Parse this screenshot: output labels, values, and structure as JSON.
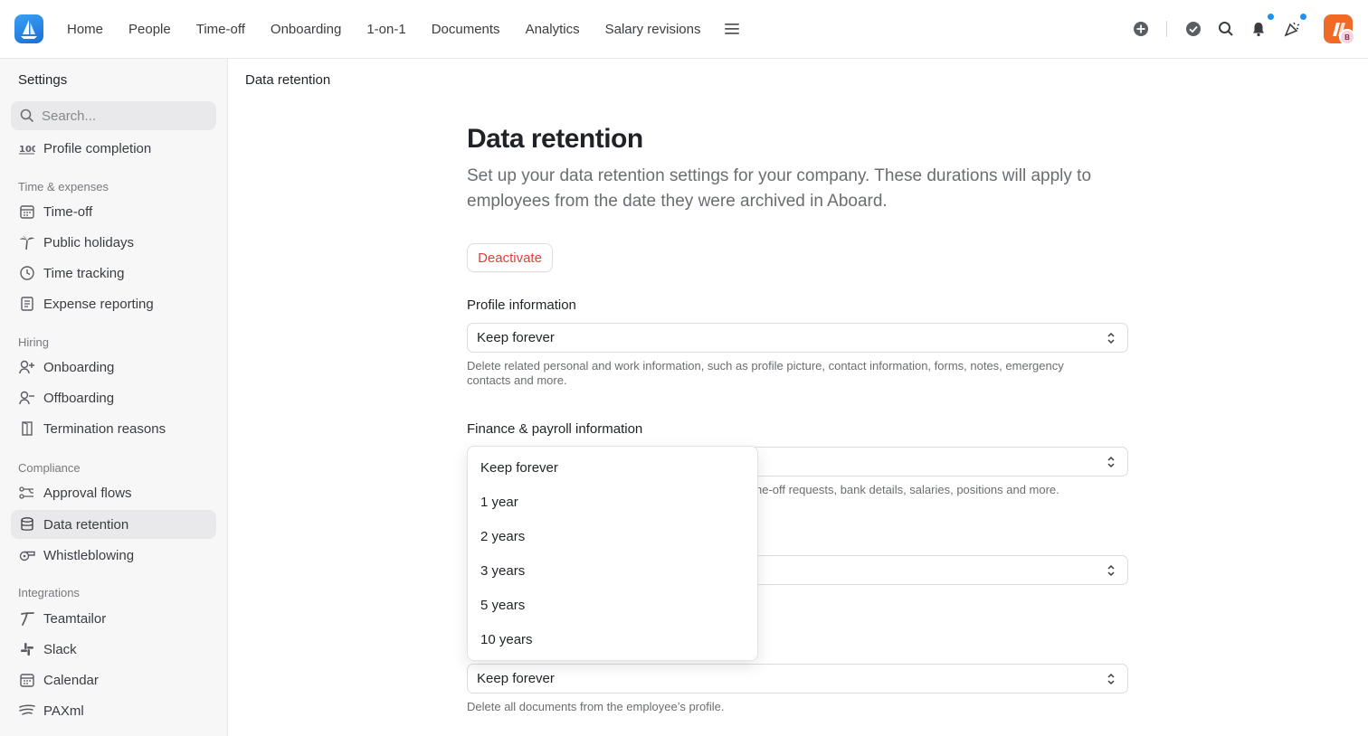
{
  "nav": {
    "items": [
      "Home",
      "People",
      "Time-off",
      "Onboarding",
      "1-on-1",
      "Documents",
      "Analytics",
      "Salary revisions"
    ],
    "menu_icon": "hamburger-icon"
  },
  "header_icons": [
    "add-circle-icon",
    "checkmark-circle-icon",
    "search-icon",
    "bell-icon",
    "party-popper-icon"
  ],
  "user": {
    "avatar_initial": "B"
  },
  "sidebar": {
    "title": "Settings",
    "search_placeholder": "Search...",
    "profile_completion": "Profile completion",
    "sections": {
      "time_expenses": "Time & expenses",
      "hiring": "Hiring",
      "compliance": "Compliance",
      "integrations": "Integrations"
    },
    "items": {
      "time_off": "Time-off",
      "public_holidays": "Public holidays",
      "time_tracking": "Time tracking",
      "expense_reporting": "Expense reporting",
      "onboarding": "Onboarding",
      "offboarding": "Offboarding",
      "termination_reasons": "Termination reasons",
      "approval_flows": "Approval flows",
      "data_retention": "Data retention",
      "whistleblowing": "Whistleblowing",
      "teamtailor": "Teamtailor",
      "slack": "Slack",
      "calendar": "Calendar",
      "paxml": "PAXml"
    },
    "active_item": "Data retention"
  },
  "breadcrumb": "Data retention",
  "page": {
    "title": "Data retention",
    "description": "Set up your data retention settings for your company. These durations will apply to employees from the date they were archived in Aboard.",
    "deactivate_label": "Deactivate"
  },
  "fields": {
    "profile": {
      "label": "Profile information",
      "value": "Keep forever",
      "help": "Delete related personal and work information, such as profile picture, contact information, forms, notes, emergency contacts and more."
    },
    "finance": {
      "label": "Finance & payroll information",
      "help_visible": "ne-off requests, bank details, salaries, positions and more."
    },
    "documents": {
      "value": "Keep forever",
      "help": "Delete all documents from the employee’s profile."
    }
  },
  "dropdown": {
    "options": [
      "Keep forever",
      "1 year",
      "2 years",
      "3 years",
      "5 years",
      "10 years"
    ]
  },
  "colors": {
    "accent_blue": "#1e90f0",
    "danger": "#e0413a",
    "avatar_orange": "#f06a25"
  }
}
